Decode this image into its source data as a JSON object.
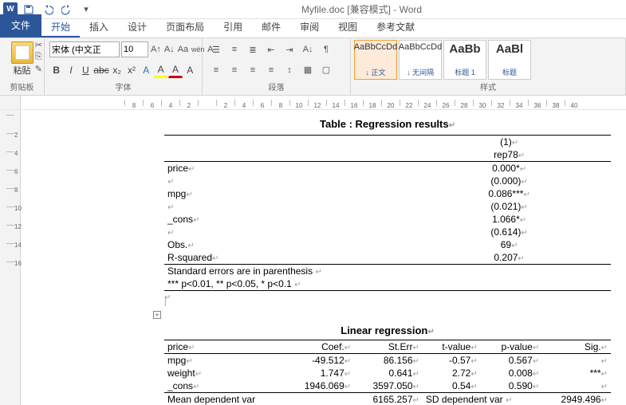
{
  "titlebar": {
    "title": "Myfile.doc [兼容模式] - Word"
  },
  "tabs": {
    "file": "文件",
    "home": "开始",
    "insert": "插入",
    "design": "设计",
    "layout": "页面布局",
    "references": "引用",
    "mailings": "邮件",
    "review": "审阅",
    "view": "视图",
    "refs2": "参考文献"
  },
  "ribbon": {
    "clipboard": {
      "label": "剪贴板",
      "paste": "粘贴"
    },
    "font": {
      "label": "字体",
      "name": "宋体 (中文正",
      "size": "10"
    },
    "paragraph": {
      "label": "段落"
    },
    "styles": {
      "label": "样式",
      "items": [
        {
          "preview": "AaBbCcDd",
          "name": "↓ 正文"
        },
        {
          "preview": "AaBbCcDd",
          "name": "↓ 无间隔"
        },
        {
          "preview": "AaBb",
          "name": "标题 1"
        },
        {
          "preview": "AaBl",
          "name": "标题"
        }
      ]
    }
  },
  "ruler": {
    "h": [
      "8",
      "6",
      "4",
      "2",
      "",
      "2",
      "4",
      "6",
      "8",
      "10",
      "12",
      "14",
      "16",
      "18",
      "20",
      "22",
      "24",
      "26",
      "28",
      "30",
      "32",
      "34",
      "36",
      "38",
      "40"
    ],
    "v": [
      "",
      "2",
      "4",
      "6",
      "8",
      "10",
      "12",
      "14",
      "16"
    ]
  },
  "doc": {
    "table1": {
      "title": "Table : Regression results",
      "col_header": "(1)",
      "col_sub": "rep78",
      "rows": [
        {
          "label": "price",
          "val": "0.000*"
        },
        {
          "label": "",
          "val": "(0.000)"
        },
        {
          "label": "mpg",
          "val": "0.086***"
        },
        {
          "label": "",
          "val": "(0.021)"
        },
        {
          "label": "_cons",
          "val": "1.066*"
        },
        {
          "label": "",
          "val": "(0.614)"
        },
        {
          "label": "Obs.",
          "val": "69"
        },
        {
          "label": "R-squared",
          "val": "0.207"
        }
      ],
      "note1": "Standard errors are in parenthesis",
      "note2": "*** p<0.01, ** p<0.05, * p<0.1"
    },
    "table2": {
      "title": "Linear regression",
      "headers": [
        "price",
        "Coef.",
        "St.Err",
        "t-value",
        "p-value",
        "Sig."
      ],
      "rows": [
        {
          "c": [
            "mpg",
            "-49.512",
            "86.156",
            "-0.57",
            "0.567",
            ""
          ]
        },
        {
          "c": [
            "weight",
            "1.747",
            "0.641",
            "2.72",
            "0.008",
            "***"
          ]
        },
        {
          "c": [
            "_cons",
            "1946.069",
            "3597.050",
            "0.54",
            "0.590",
            ""
          ]
        }
      ],
      "summary": {
        "l1": "Mean dependent var",
        "v1": "6165.257",
        "l2": "SD dependent var",
        "v2": "2949.496"
      }
    }
  }
}
